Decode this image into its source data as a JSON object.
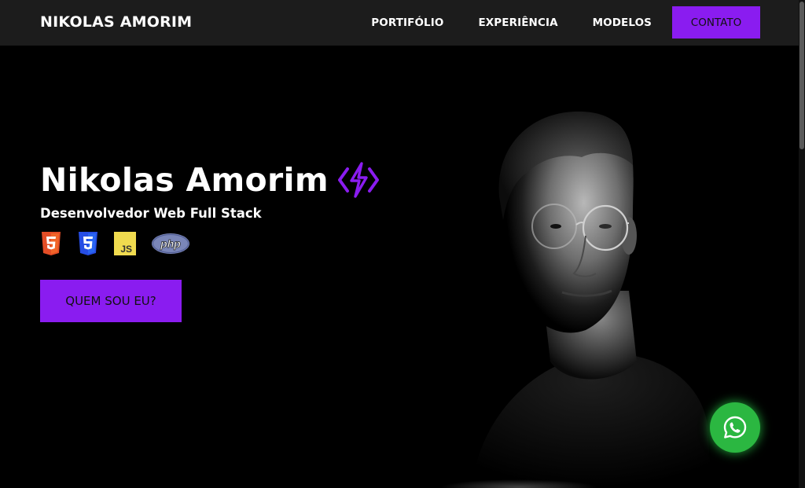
{
  "navbar": {
    "brand": "NIKOLAS AMORIM",
    "links": [
      {
        "label": "PORTIFÓLIO"
      },
      {
        "label": "EXPERIÊNCIA"
      },
      {
        "label": "MODELOS"
      }
    ],
    "cta_label": "CONTATO"
  },
  "hero": {
    "title": "Nikolas Amorim",
    "subtitle": "Desenvolvedor Web Full Stack",
    "tech_icons": [
      "html5-icon",
      "css3-icon",
      "javascript-icon",
      "php-icon"
    ],
    "tech_labels": {
      "js": "JS",
      "php": "php"
    },
    "cta_label": "QUEM SOU EU?"
  },
  "floating": {
    "whatsapp_icon": "whatsapp-icon"
  },
  "colors": {
    "accent": "#8a1cf0",
    "navbar_bg": "#1c1c1c",
    "page_bg": "#000000",
    "whatsapp": "#2bb741"
  }
}
